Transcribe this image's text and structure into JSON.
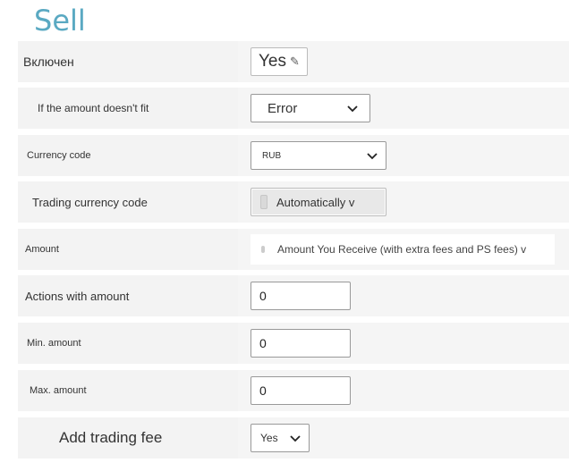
{
  "page": {
    "title": "Sell"
  },
  "rows": {
    "enabled": {
      "label": "Включен",
      "value": "Yes"
    },
    "amount_not_fit": {
      "label": "If the amount doesn't fit",
      "value": "Error"
    },
    "currency_code": {
      "label": "Currency code",
      "value": "RUB"
    },
    "trading_currency_code": {
      "label": "Trading currency code",
      "value": "Automatically v"
    },
    "amount": {
      "label": "Amount",
      "value": "Amount You Receive (with extra fees and PS fees) v"
    },
    "actions_with_amount": {
      "label": "Actions with amount",
      "value": "0"
    },
    "min_amount": {
      "label": "Min. amount",
      "value": "0"
    },
    "max_amount": {
      "label": "Max. amount",
      "value": "0"
    },
    "add_trading_fee": {
      "label": "Add trading fee",
      "value": "Yes"
    }
  },
  "icons": {
    "pencil": "pencil-icon",
    "chevron": "chevron-down-icon"
  },
  "colors": {
    "title": "#5aa9c2",
    "row_background": "#f3f3f3"
  }
}
